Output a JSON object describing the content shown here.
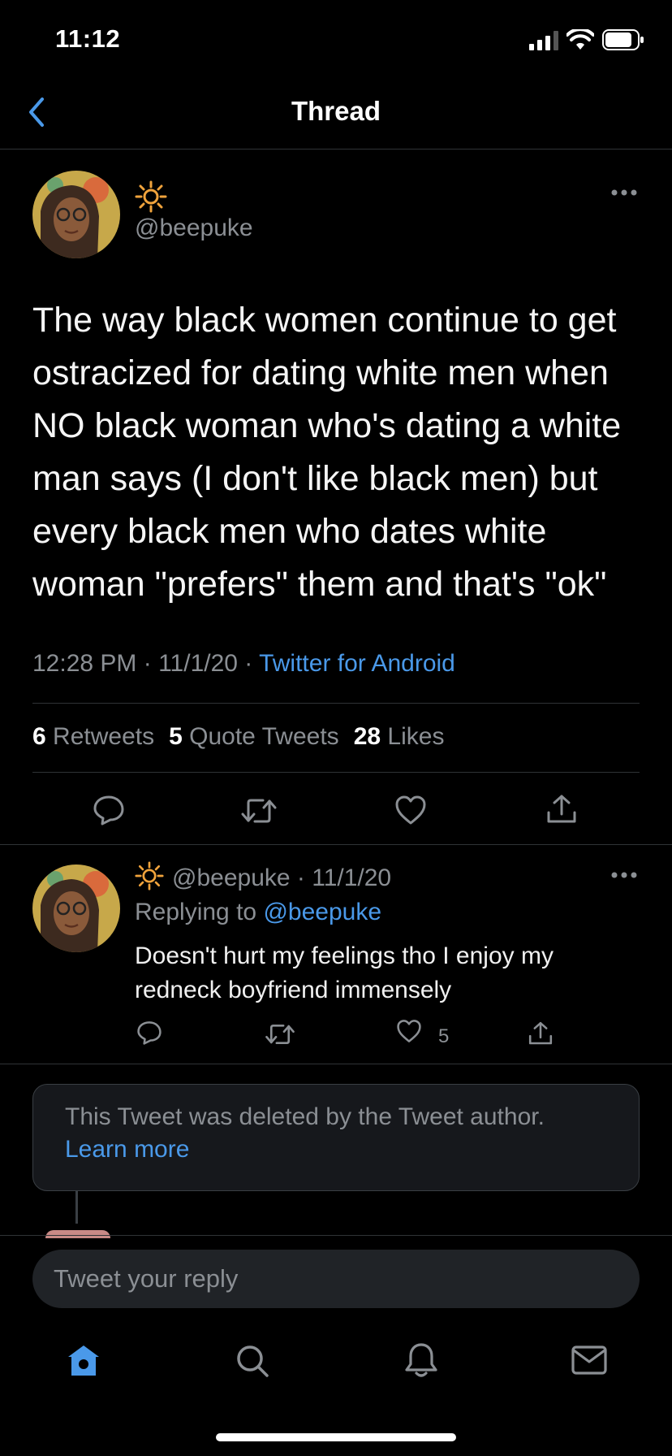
{
  "status_bar": {
    "time": "11:12"
  },
  "header": {
    "title": "Thread"
  },
  "main_tweet": {
    "handle": "@beepuke",
    "text": "The way black women continue to get ostracized for dating white men when NO black woman who's dating a white man says (I don't like black men) but every black men who dates white woman \"prefers\" them and that's \"ok\"",
    "time": "12:28 PM",
    "date": "11/1/20",
    "source": "Twitter for Android",
    "retweets_count": "6",
    "retweets_label": "Retweets",
    "quotes_count": "5",
    "quotes_label": "Quote Tweets",
    "likes_count": "28",
    "likes_label": "Likes"
  },
  "reply_tweet": {
    "handle": "@beepuke",
    "date": "11/1/20",
    "replying_prefix": "Replying to",
    "replying_handle": "@beepuke",
    "text": "Doesn't hurt my feelings tho I enjoy my redneck boyfriend immensely",
    "like_count": "5"
  },
  "deleted_notice": {
    "text": "This Tweet was deleted by the Tweet author.",
    "link": "Learn more"
  },
  "reply_bar": {
    "placeholder": "Tweet your reply"
  },
  "colors": {
    "accent": "#4a99e9",
    "background": "#000000",
    "muted": "#8b8f94"
  },
  "icons": [
    "back-chevron-icon",
    "more-icon",
    "reply-icon",
    "retweet-icon",
    "like-icon",
    "share-icon",
    "home-icon",
    "search-icon",
    "notifications-icon",
    "messages-icon"
  ]
}
